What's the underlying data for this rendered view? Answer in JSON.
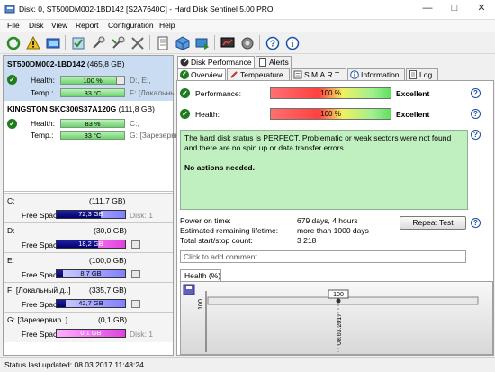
{
  "window": {
    "title": "Disk: 0, ST500DM002-1BD142 [S2A7640C]  -  Hard Disk Sentinel 5.00 PRO",
    "controls": [
      "—",
      "□",
      "✕"
    ]
  },
  "menu": [
    "File",
    "Disk",
    "View",
    "Report",
    "Configuration",
    "Help"
  ],
  "toolbar": [
    "refresh-icon",
    "alert-icon",
    "report-icon",
    "test-icon",
    "surface-test-icon",
    "repair-icon",
    "tools-icon",
    "document-icon",
    "cube-icon",
    "send-icon",
    "monitor-chart-icon",
    "settings-icon",
    "help-icon",
    "info-icon"
  ],
  "disks": [
    {
      "name": "ST500DM002-1BD142",
      "size": "(465,8 GB)",
      "health_label": "Health:",
      "health_value": "100 %",
      "health_fraction": 1.0,
      "temp_label": "Temp.:",
      "temp_value": "33 °C",
      "partitions_1": "D:, E:,",
      "partitions_2": "F: [Локальный",
      "selected": true
    },
    {
      "name": "KINGSTON SKC300S37A120G",
      "size": "(111,8 GB)",
      "health_label": "Health:",
      "health_value": "83 %",
      "health_fraction": 0.83,
      "temp_label": "Temp.:",
      "temp_value": "33 °C",
      "partitions_1": "C:,",
      "partitions_2": "G: [Зарезервир",
      "selected": false
    }
  ],
  "volumes": [
    {
      "name": "C:",
      "size": "(111,7 GB)",
      "free_label": "Free Space",
      "free": "72,3 GB",
      "free_fraction": 0.647,
      "disk": "Disk: 1",
      "pink": false
    },
    {
      "name": "D:",
      "size": "(30,0 GB)",
      "free_label": "Free Space",
      "free": "18,2 GB",
      "free_fraction": 0.607,
      "disk": "Disk: 0",
      "pink": true
    },
    {
      "name": "E:",
      "size": "(100,0 GB)",
      "free_label": "Free Space",
      "free": "8,7 GB",
      "free_fraction": 0.087,
      "disk": "Disk: 0",
      "pink": false
    },
    {
      "name": "F: [Локальный д..]",
      "size": "(335,7 GB)",
      "free_label": "Free Space",
      "free": "42,7 GB",
      "free_fraction": 0.127,
      "disk": "Disk: 0",
      "pink": false
    },
    {
      "name": "G: [Зарезервир..]",
      "size": "(0,1 GB)",
      "free_label": "Free Space",
      "free": "0.1 GB",
      "free_fraction": 0.0,
      "disk": "Disk: 1",
      "pink": true
    }
  ],
  "top_tabs": [
    "Disk Performance",
    "Alerts"
  ],
  "tabs": [
    "Overview",
    "Temperature",
    "S.M.A.R.T.",
    "Information",
    "Log"
  ],
  "overview": {
    "performance_label": "Performance:",
    "performance_value": "100 %",
    "performance_rating": "Excellent",
    "health_label": "Health:",
    "health_value": "100 %",
    "health_rating": "Excellent",
    "status_line1": "The hard disk status is PERFECT. Problematic or weak sectors were not found",
    "status_line2": "and there are no spin up or data transfer errors.",
    "status_line3": "No actions needed.",
    "power_on_label": "Power on time:",
    "power_on_value": "679 days, 4 hours",
    "remaining_label": "Estimated remaining lifetime:",
    "remaining_value": "more than 1000 days",
    "startstop_label": "Total start/stop count:",
    "startstop_value": "3 218",
    "repeat_test": "Repeat Test",
    "comment_placeholder": "Click to add comment ...",
    "health_tab": "Health (%)"
  },
  "chart_data": {
    "type": "line",
    "x": [
      "08.03.2017"
    ],
    "series": [
      {
        "values": [
          100
        ]
      }
    ],
    "ylabel": "100",
    "data_labels": [
      "100"
    ]
  },
  "status": "Status last updated: 08.03.2017 11:48:24"
}
